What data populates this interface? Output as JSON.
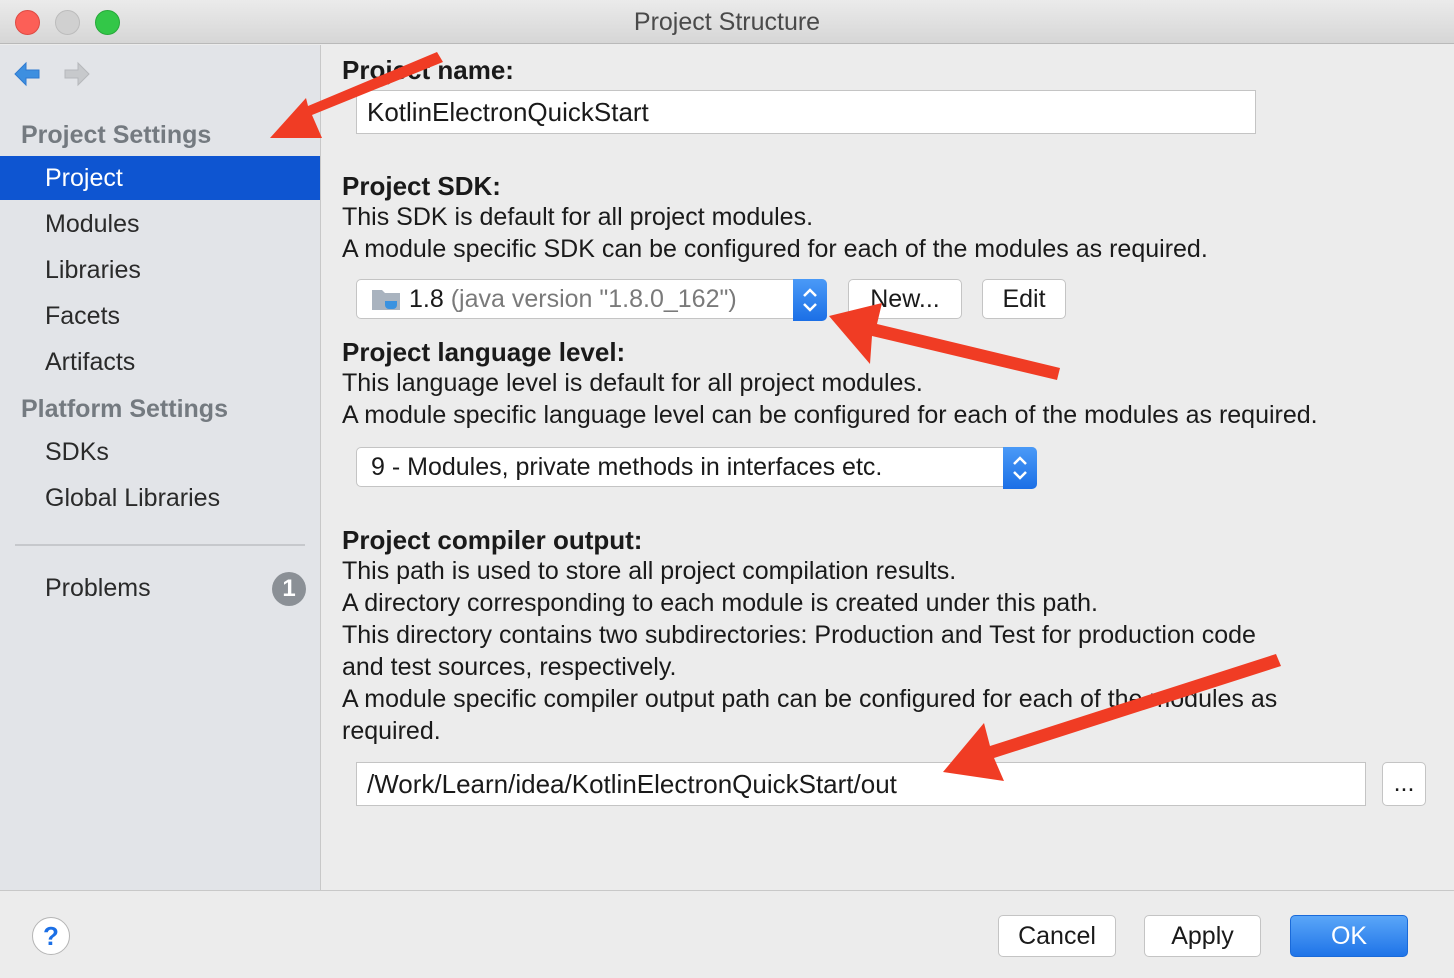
{
  "window": {
    "title": "Project Structure"
  },
  "sidebar": {
    "project_settings_heading": "Project Settings",
    "platform_settings_heading": "Platform Settings",
    "project_items": [
      "Project",
      "Modules",
      "Libraries",
      "Facets",
      "Artifacts"
    ],
    "platform_items": [
      "SDKs",
      "Global Libraries"
    ],
    "problems_label": "Problems",
    "problems_count": "1",
    "selected": "Project"
  },
  "main": {
    "project_name": {
      "label": "Project name:",
      "value": "KotlinElectronQuickStart"
    },
    "project_sdk": {
      "label": "Project SDK:",
      "desc_lines": [
        "This SDK is default for all project modules.",
        "A module specific SDK can be configured for each of the modules as required."
      ],
      "selected_version": "1.8",
      "selected_detail": "(java version \"1.8.0_162\")",
      "new_button": "New...",
      "edit_button": "Edit"
    },
    "language_level": {
      "label": "Project language level:",
      "desc_lines": [
        "This language level is default for all project modules.",
        "A module specific language level can be configured for each of the modules as required."
      ],
      "selected": "9 - Modules, private methods in interfaces etc."
    },
    "compiler_output": {
      "label": "Project compiler output:",
      "desc_lines": [
        "This path is used to store all project compilation results.",
        "A directory corresponding to each module is created under this path.",
        "This directory contains two subdirectories: Production and Test for production code",
        "and test sources, respectively.",
        "A module specific compiler output path can be configured for each of the modules as",
        "required."
      ],
      "path": "/Work/Learn/idea/KotlinElectronQuickStart/out",
      "browse_button": "..."
    }
  },
  "footer": {
    "help_label": "?",
    "cancel_button": "Cancel",
    "apply_button": "Apply",
    "ok_button": "OK"
  },
  "colors": {
    "selection_blue": "#0e55d1",
    "accent_blue": "#1f74e8",
    "annotation_red": "#f03c24"
  }
}
